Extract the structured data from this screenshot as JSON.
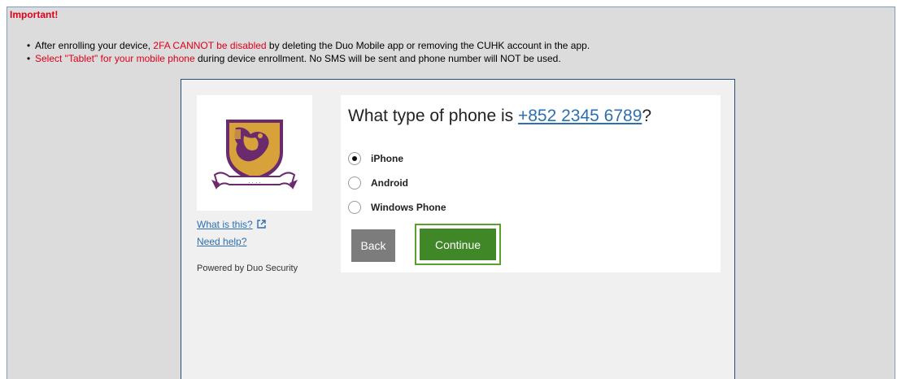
{
  "notice": {
    "title": "Important!",
    "line1": {
      "pre": "After enrolling your device, ",
      "red": "2FA CANNOT be disabled",
      "post": " by deleting the Duo Mobile app or removing the CUHK account in the app."
    },
    "line2": {
      "red": "Select \"Tablet\" for your mobile phone",
      "post": " during device enrollment. No SMS will be sent and phone number will NOT be used."
    }
  },
  "sidebar": {
    "logo_icon": "cuhk-crest",
    "what_is_this": "What is this?",
    "need_help": "Need help?",
    "powered_by": "Powered by Duo Security"
  },
  "prompt": {
    "question_pre": "What type of phone is ",
    "phone_number": "+852 2345 6789",
    "question_post": "?",
    "options": [
      {
        "label": "iPhone",
        "selected": true
      },
      {
        "label": "Android",
        "selected": false
      },
      {
        "label": "Windows Phone",
        "selected": false
      }
    ],
    "back_label": "Back",
    "continue_label": "Continue"
  },
  "colors": {
    "notice_red": "#e0001b",
    "link_blue": "#2d6fb0",
    "continue_green": "#3f8727",
    "back_gray": "#7c7c7c",
    "crest_purple": "#6b2a6e",
    "crest_gold": "#d8a23a"
  }
}
